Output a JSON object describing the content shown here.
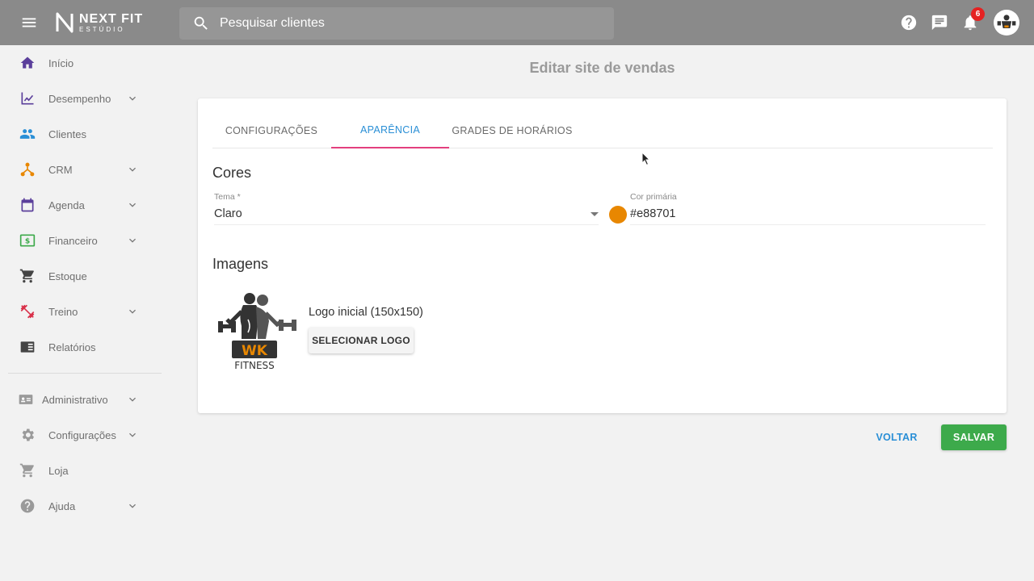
{
  "app": {
    "brand_name": "NEXT FIT",
    "brand_sub": "ESTÚDIO",
    "search_placeholder": "Pesquisar clientes",
    "notification_count": "6"
  },
  "sidebar": {
    "items": [
      {
        "label": "Início",
        "icon": "home-icon",
        "color": "#5b3f9b",
        "expandable": false
      },
      {
        "label": "Desempenho",
        "icon": "chart-line-icon",
        "color": "#5b3f9b",
        "expandable": true
      },
      {
        "label": "Clientes",
        "icon": "people-icon",
        "color": "#2a8fd6",
        "expandable": false
      },
      {
        "label": "CRM",
        "icon": "crm-network-icon",
        "color": "#e88701",
        "expandable": true
      },
      {
        "label": "Agenda",
        "icon": "calendar-icon",
        "color": "#5b3f9b",
        "expandable": true
      },
      {
        "label": "Financeiro",
        "icon": "money-icon",
        "color": "#3daa4b",
        "expandable": true
      },
      {
        "label": "Estoque",
        "icon": "cart-icon",
        "color": "#444444",
        "expandable": false
      },
      {
        "label": "Treino",
        "icon": "dumbbell-icon",
        "color": "#d9314a",
        "expandable": true
      },
      {
        "label": "Relatórios",
        "icon": "report-icon",
        "color": "#444444",
        "expandable": false
      },
      {
        "label": "Administrativo",
        "icon": "id-card-icon",
        "color": "#9a9a9a",
        "expandable": true
      },
      {
        "label": "Configurações",
        "icon": "gear-icon",
        "color": "#9a9a9a",
        "expandable": true
      },
      {
        "label": "Loja",
        "icon": "cart-icon",
        "color": "#9a9a9a",
        "expandable": false
      },
      {
        "label": "Ajuda",
        "icon": "help-icon",
        "color": "#9a9a9a",
        "expandable": true
      }
    ]
  },
  "page": {
    "title": "Editar site de vendas"
  },
  "tabs": [
    {
      "label": "CONFIGURAÇÕES",
      "active": false
    },
    {
      "label": "APARÊNCIA",
      "active": true
    },
    {
      "label": "GRADES DE HORÁRIOS",
      "active": false
    }
  ],
  "cores": {
    "title": "Cores",
    "tema_label": "Tema *",
    "tema_value": "Claro",
    "cor_label": "Cor primária",
    "cor_value": "#e88701",
    "swatch_color": "#e88701"
  },
  "imagens": {
    "title": "Imagens",
    "logo_caption": "Logo inicial (150x150)",
    "select_button": "SELECIONAR LOGO",
    "logo_text_wk": "WK",
    "logo_text_fitness": "FITNESS"
  },
  "actions": {
    "back": "VOLTAR",
    "save": "SALVAR"
  },
  "colors": {
    "accent_blue": "#2a8fd6",
    "tab_indicator": "#e3407e",
    "save_green": "#3daa4b",
    "topbar": "#8a8a8a"
  }
}
